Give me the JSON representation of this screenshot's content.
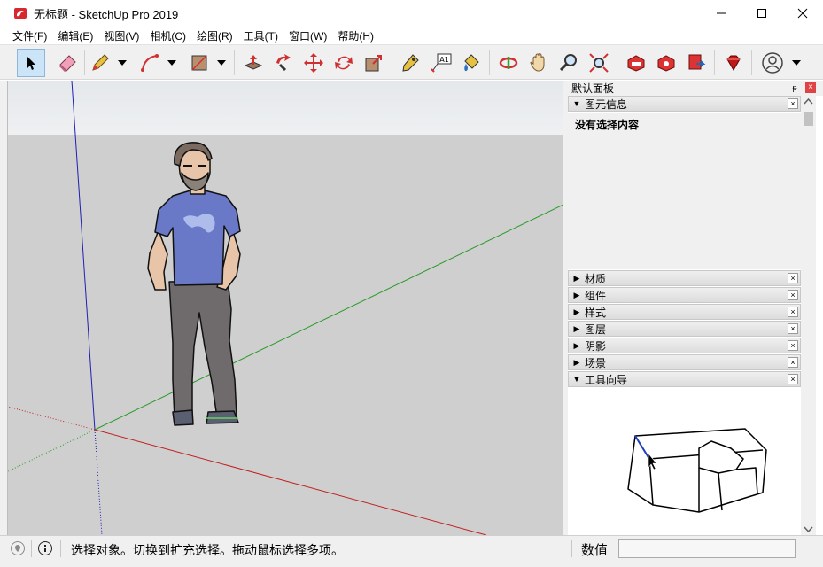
{
  "window": {
    "title": "无标题 - SketchUp Pro 2019"
  },
  "menu": [
    "文件(F)",
    "编辑(E)",
    "视图(V)",
    "相机(C)",
    "绘图(R)",
    "工具(T)",
    "窗口(W)",
    "帮助(H)"
  ],
  "toolbar": {
    "text_tool_label": "A1"
  },
  "tray": {
    "title": "默认面板",
    "pin_glyph": "ᵽ",
    "close_glyph": "×",
    "entity_info": {
      "title": "图元信息",
      "message": "没有选择内容",
      "expanded": true
    },
    "panels": [
      {
        "title": "材质",
        "expanded": false
      },
      {
        "title": "组件",
        "expanded": false
      },
      {
        "title": "样式",
        "expanded": false
      },
      {
        "title": "图层",
        "expanded": false
      },
      {
        "title": "阴影",
        "expanded": false
      },
      {
        "title": "场景",
        "expanded": false
      },
      {
        "title": "工具向导",
        "expanded": true
      }
    ],
    "close_glyph_small": "×"
  },
  "statusbar": {
    "message": "选择对象。切换到扩充选择。拖动鼠标选择多项。",
    "measure_label": "数值",
    "measure_value": ""
  },
  "colors": {
    "viewport_ground": "#cfcfcf",
    "viewport_sky": "#e8ebee",
    "axis_red": "#c02020",
    "axis_green": "#2a9a2a",
    "axis_blue": "#2020b0",
    "tray_close": "#e04343",
    "toolbar_active": "#cce4f7"
  }
}
